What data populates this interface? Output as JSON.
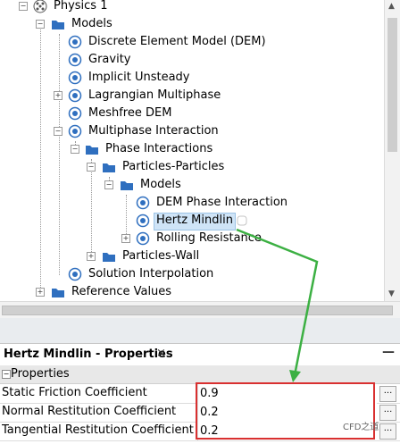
{
  "tree": {
    "root": {
      "label": "Physics 1"
    },
    "nodes": [
      {
        "label": "Models"
      },
      {
        "label": "Discrete Element Model (DEM)"
      },
      {
        "label": "Gravity"
      },
      {
        "label": "Implicit Unsteady"
      },
      {
        "label": "Lagrangian Multiphase"
      },
      {
        "label": "Meshfree DEM"
      },
      {
        "label": "Multiphase Interaction"
      },
      {
        "label": "Phase Interactions"
      },
      {
        "label": "Particles-Particles"
      },
      {
        "label": "Models"
      },
      {
        "label": "DEM Phase Interaction"
      },
      {
        "label": "Hertz Mindlin"
      },
      {
        "label": "Rolling Resistance"
      },
      {
        "label": "Particles-Wall"
      },
      {
        "label": "Solution Interpolation"
      },
      {
        "label": "Reference Values"
      }
    ]
  },
  "properties_panel": {
    "title": "Hertz Mindlin - Properties",
    "close_glyph": "×",
    "minimize_glyph": "—",
    "section_label": "Properties",
    "rows": [
      {
        "name": "Static Friction Coefficient",
        "value": "0.9",
        "button": "..."
      },
      {
        "name": "Normal Restitution Coefficient",
        "value": "0.2",
        "button": "..."
      },
      {
        "name": "Tangential Restitution Coefficient",
        "value": "0.2",
        "button": "..."
      }
    ]
  },
  "watermark": {
    "text": "CFD之道"
  },
  "colors": {
    "accent_arrow": "#3cb043",
    "highlight_border": "#d93030",
    "selection_bg": "#cfe4f7",
    "folder": "#2f6fbf"
  },
  "icons": {
    "root": "atom-physics-icon",
    "folder": "folder-icon",
    "model": "model-node-icon"
  }
}
